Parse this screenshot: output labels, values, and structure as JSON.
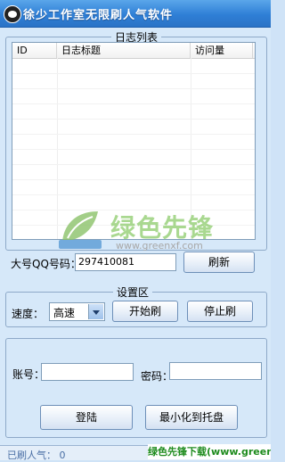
{
  "window": {
    "title": "徐少工作室无限刷人气软件",
    "minimize_glyph": "–",
    "close_glyph": "×"
  },
  "log_list": {
    "legend": "日志列表",
    "columns": [
      "ID",
      "日志标题",
      "访问量"
    ]
  },
  "watermark": {
    "logo_text": "GREENXF.COM",
    "brand": "绿色先锋",
    "url": "www.greenxf.com"
  },
  "qq": {
    "label": "大号QQ号码：",
    "value": "297410081",
    "refresh_button": "刷新"
  },
  "settings": {
    "legend": "设置区",
    "speed_label": "速度：",
    "speed_value": "高速",
    "start_button": "开始刷",
    "stop_button": "停止刷"
  },
  "login": {
    "account_label": "账号：",
    "account_value": "",
    "password_label": "密码：",
    "password_value": "",
    "login_button": "登陆",
    "tray_button": "最小化到托盘"
  },
  "status": {
    "text": "已刷人气：  0"
  },
  "banner": {
    "text": "绿色先锋下载(www.greenxf.com)"
  },
  "colors": {
    "titlebar": "#2f7fd6",
    "panel": "#d6e8f9",
    "banner_text": "#1d8b1d"
  }
}
